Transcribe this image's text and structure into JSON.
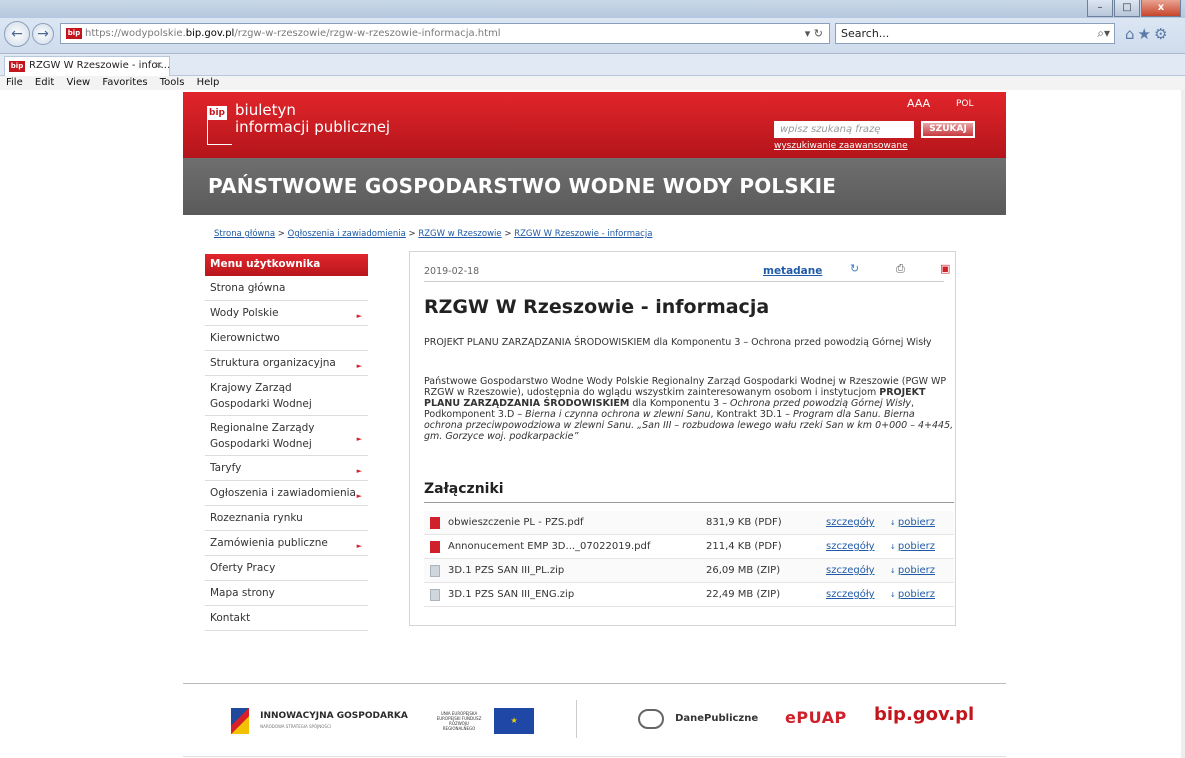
{
  "browser": {
    "url_prefix": "https://wodypolskie.",
    "url_domain": "bip.gov.pl",
    "url_path": "/rzgw-w-rzeszowie/rzgw-w-rzeszowie-informacja.html",
    "url_controls": "▾ ↻",
    "search_placeholder": "Search...",
    "tab_title": "RZGW W Rzeszowie - infor...",
    "menu": [
      "File",
      "Edit",
      "View",
      "Favorites",
      "Tools",
      "Help"
    ]
  },
  "header": {
    "logo_mark": "bip",
    "logo_line1": "biuletyn",
    "logo_line2": "informacji publicznej",
    "font_sizes": "AAA",
    "lang": "POL",
    "search_placeholder": "wpisz szukaną frazę",
    "search_button": "SZUKAJ",
    "advanced_search": "wyszukiwanie zaawansowane",
    "institution": "PAŃSTWOWE GOSPODARSTWO WODNE WODY POLSKIE"
  },
  "breadcrumb": {
    "items": [
      "Strona główna",
      "Ogłoszenia i zawiadomienia",
      "RZGW w Rzeszowie",
      "RZGW W Rzeszowie - informacja"
    ],
    "sep": " > "
  },
  "sidebar": {
    "title": "Menu użytkownika",
    "items": [
      {
        "label": "Strona główna",
        "arrow": false
      },
      {
        "label": "Wody Polskie",
        "arrow": true
      },
      {
        "label": "Kierownictwo",
        "arrow": false
      },
      {
        "label": "Struktura organizacyjna",
        "arrow": true
      },
      {
        "label": "Krajowy Zarząd Gospodarki Wodnej",
        "arrow": false
      },
      {
        "label": "Regionalne Zarządy Gospodarki Wodnej",
        "arrow": true
      },
      {
        "label": "Taryfy",
        "arrow": true
      },
      {
        "label": "Ogłoszenia i zawiadomienia",
        "arrow": true
      },
      {
        "label": "Rozeznania rynku",
        "arrow": false
      },
      {
        "label": "Zamówienia publiczne",
        "arrow": true
      },
      {
        "label": "Oferty Pracy",
        "arrow": false
      },
      {
        "label": "Mapa strony",
        "arrow": false
      },
      {
        "label": "Kontakt",
        "arrow": false
      }
    ]
  },
  "content": {
    "date": "2019-02-18",
    "metadata_link": "metadane",
    "title": "RZGW W Rzeszowie - informacja",
    "paragraph1": "PROJEKT PLANU ZARZĄDZANIA ŚRODOWISKIEM dla Komponentu 3 – Ochrona przed powodzią Górnej Wisły",
    "p2_a": "Państwowe Gospodarstwo Wodne Wody Polskie Regionalny Zarząd Gospodarki Wodnej w Rzeszowie (PGW WP RZGW w Rzeszowie), udostępnia do wglądu wszystkim zainteresowanym osobom i instytucjom ",
    "p2_b": "PROJEKT PLANU ZARZĄDZANIA ŚRODOWISKIEM",
    "p2_c": " dla Komponentu 3 – ",
    "p2_d": "Ochrona przed powodzią Górnej Wisły",
    "p2_e": ", Podkomponent 3.D – ",
    "p2_f": "Bierna i czynna ochrona w zlewni Sanu",
    "p2_g": ", Kontrakt 3D.1 – ",
    "p2_h": "Program dla Sanu. Bierna ochrona przeciwpowodziowa w zlewni Sanu. „San III – rozbudowa lewego wału rzeki San w km 0+000 – 4+445, gm. Gorzyce woj. podkarpackie”",
    "attachments_title": "Załączniki",
    "attachments": [
      {
        "type": "pdf",
        "name": "obwieszczenie PL - PZS.pdf",
        "size": "831,9 KB (PDF)",
        "details": "szczegóły",
        "download": "pobierz"
      },
      {
        "type": "pdf",
        "name": "Annonucement EMP 3D..._07022019.pdf",
        "size": "211,4 KB (PDF)",
        "details": "szczegóły",
        "download": "pobierz"
      },
      {
        "type": "zip",
        "name": "3D.1 PZS SAN III_PL.zip",
        "size": "26,09 MB (ZIP)",
        "details": "szczegóły",
        "download": "pobierz"
      },
      {
        "type": "zip",
        "name": "3D.1 PZS SAN III_ENG.zip",
        "size": "22,49 MB (ZIP)",
        "details": "szczegóły",
        "download": "pobierz"
      }
    ]
  },
  "footer": {
    "ig_title": "INNOWACYJNA GOSPODARKA",
    "ig_sub": "NARODOWA STRATEGIA SPÓJNOŚCI",
    "ue_text": "UNIA EUROPEJSKA EUROPEJSKI FUNDUSZ ROZWOJU REGIONALNEGO",
    "dane": "DanePubliczne",
    "epuap": "ePUAP",
    "bip": "bip.gov.pl"
  },
  "colors": {
    "brand_red": "#c3161c",
    "link": "#1f5aa6",
    "gray_bar": "#646464"
  }
}
